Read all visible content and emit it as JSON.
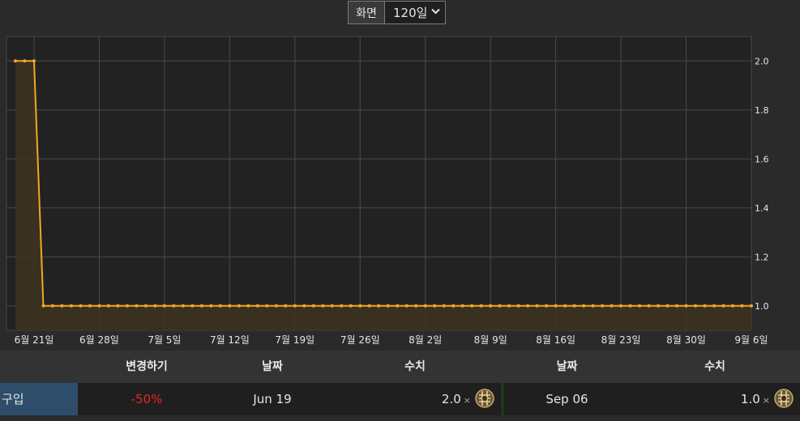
{
  "header": {
    "view_label": "화면",
    "view_value": "120일"
  },
  "table": {
    "headers": {
      "change": "변경하기",
      "date1": "날짜",
      "value1": "수치",
      "date2": "날짜",
      "value2": "수치"
    },
    "row": {
      "type": "구입",
      "change": "-50%",
      "date1": "Jun 19",
      "value1": "2.0",
      "times1": "×",
      "date2": "Sep 06",
      "value2": "1.0",
      "times2": "×"
    },
    "currency_icon": "orb-icon"
  },
  "colors": {
    "line": "#f5a623",
    "fill": "#3d3220",
    "plot_bg": "#222222",
    "grid": "#4a4a4a",
    "change_negative": "#e8261f",
    "type_cell": "#2e4d6b"
  },
  "chart_data": {
    "type": "area",
    "title": "",
    "xlabel": "",
    "ylabel": "",
    "ylim": [
      0.9,
      2.1
    ],
    "y_ticks": [
      "1.0",
      "1.2",
      "1.4",
      "1.6",
      "1.8",
      "2.0"
    ],
    "x_ticks": [
      "6월 21일",
      "6월 28일",
      "7월 5일",
      "7월 12일",
      "7월 19일",
      "7월 26일",
      "8월 2일",
      "8월 9일",
      "8월 16일",
      "8월 23일",
      "8월 30일",
      "9월 6일"
    ],
    "grid": true,
    "series": [
      {
        "points": [
          [
            "2024-06-19",
            2.0
          ],
          [
            "2024-06-20",
            2.0
          ],
          [
            "2024-06-21",
            2.0
          ],
          [
            "2024-06-22",
            1.0
          ],
          [
            "2024-06-23",
            1.0
          ],
          [
            "2024-06-24",
            1.0
          ],
          [
            "2024-06-25",
            1.0
          ],
          [
            "2024-06-26",
            1.0
          ],
          [
            "2024-06-27",
            1.0
          ],
          [
            "2024-06-28",
            1.0
          ],
          [
            "2024-06-29",
            1.0
          ],
          [
            "2024-06-30",
            1.0
          ],
          [
            "2024-07-01",
            1.0
          ],
          [
            "2024-07-02",
            1.0
          ],
          [
            "2024-07-03",
            1.0
          ],
          [
            "2024-07-04",
            1.0
          ],
          [
            "2024-07-05",
            1.0
          ],
          [
            "2024-07-06",
            1.0
          ],
          [
            "2024-07-07",
            1.0
          ],
          [
            "2024-07-08",
            1.0
          ],
          [
            "2024-07-09",
            1.0
          ],
          [
            "2024-07-10",
            1.0
          ],
          [
            "2024-07-11",
            1.0
          ],
          [
            "2024-07-12",
            1.0
          ],
          [
            "2024-07-13",
            1.0
          ],
          [
            "2024-07-14",
            1.0
          ],
          [
            "2024-07-15",
            1.0
          ],
          [
            "2024-07-16",
            1.0
          ],
          [
            "2024-07-17",
            1.0
          ],
          [
            "2024-07-18",
            1.0
          ],
          [
            "2024-07-19",
            1.0
          ],
          [
            "2024-07-20",
            1.0
          ],
          [
            "2024-07-21",
            1.0
          ],
          [
            "2024-07-22",
            1.0
          ],
          [
            "2024-07-23",
            1.0
          ],
          [
            "2024-07-24",
            1.0
          ],
          [
            "2024-07-25",
            1.0
          ],
          [
            "2024-07-26",
            1.0
          ],
          [
            "2024-07-27",
            1.0
          ],
          [
            "2024-07-28",
            1.0
          ],
          [
            "2024-07-29",
            1.0
          ],
          [
            "2024-07-30",
            1.0
          ],
          [
            "2024-07-31",
            1.0
          ],
          [
            "2024-08-01",
            1.0
          ],
          [
            "2024-08-02",
            1.0
          ],
          [
            "2024-08-03",
            1.0
          ],
          [
            "2024-08-04",
            1.0
          ],
          [
            "2024-08-05",
            1.0
          ],
          [
            "2024-08-06",
            1.0
          ],
          [
            "2024-08-07",
            1.0
          ],
          [
            "2024-08-08",
            1.0
          ],
          [
            "2024-08-09",
            1.0
          ],
          [
            "2024-08-10",
            1.0
          ],
          [
            "2024-08-11",
            1.0
          ],
          [
            "2024-08-12",
            1.0
          ],
          [
            "2024-08-13",
            1.0
          ],
          [
            "2024-08-14",
            1.0
          ],
          [
            "2024-08-15",
            1.0
          ],
          [
            "2024-08-16",
            1.0
          ],
          [
            "2024-08-17",
            1.0
          ],
          [
            "2024-08-18",
            1.0
          ],
          [
            "2024-08-19",
            1.0
          ],
          [
            "2024-08-20",
            1.0
          ],
          [
            "2024-08-21",
            1.0
          ],
          [
            "2024-08-22",
            1.0
          ],
          [
            "2024-08-23",
            1.0
          ],
          [
            "2024-08-24",
            1.0
          ],
          [
            "2024-08-25",
            1.0
          ],
          [
            "2024-08-26",
            1.0
          ],
          [
            "2024-08-27",
            1.0
          ],
          [
            "2024-08-28",
            1.0
          ],
          [
            "2024-08-29",
            1.0
          ],
          [
            "2024-08-30",
            1.0
          ],
          [
            "2024-08-31",
            1.0
          ],
          [
            "2024-09-01",
            1.0
          ],
          [
            "2024-09-02",
            1.0
          ],
          [
            "2024-09-03",
            1.0
          ],
          [
            "2024-09-04",
            1.0
          ],
          [
            "2024-09-05",
            1.0
          ],
          [
            "2024-09-06",
            1.0
          ]
        ]
      }
    ]
  }
}
